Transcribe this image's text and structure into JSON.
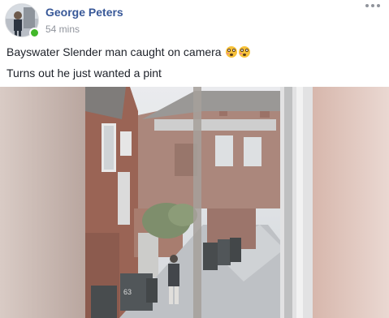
{
  "post": {
    "author": "George Peters",
    "time": "54 mins",
    "lines": [
      "Bayswater Slender man caught on camera",
      "Turns out he just wanted a pint"
    ],
    "emojis": [
      "flushed-face",
      "flushed-face"
    ],
    "bin_number": "63"
  },
  "icons": {
    "more": "more-options-icon",
    "online": "online-status-icon",
    "emoji": "flushed-face-icon"
  },
  "colors": {
    "author_link": "#385898",
    "meta_gray": "#90949c",
    "online_green": "#42b72a",
    "body_text": "#1d2129"
  }
}
